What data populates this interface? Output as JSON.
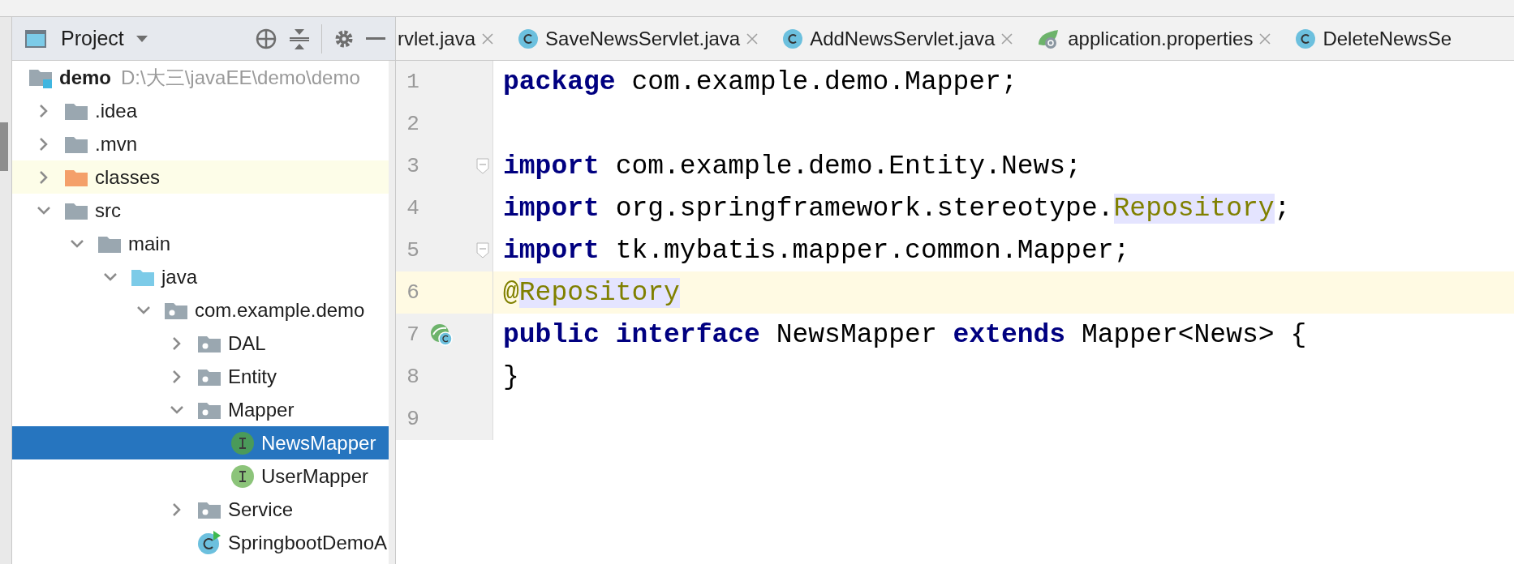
{
  "tool_window": {
    "title": "Project"
  },
  "editor_tabs": [
    {
      "label": "rvlet.java",
      "kind": "partial"
    },
    {
      "label": "SaveNewsServlet.java",
      "kind": "class"
    },
    {
      "label": "AddNewsServlet.java",
      "kind": "class"
    },
    {
      "label": "application.properties",
      "kind": "spring-config"
    },
    {
      "label": "DeleteNewsSe",
      "kind": "class",
      "closable": false
    }
  ],
  "project_tree": {
    "root": {
      "label": "demo",
      "path": "D:\\大三\\javaEE\\demo\\demo",
      "kind": "module",
      "selected": false,
      "highlighted": false,
      "children": [
        {
          "label": ".idea",
          "kind": "folder",
          "expanded": false,
          "selected": false,
          "highlighted": false
        },
        {
          "label": ".mvn",
          "kind": "folder",
          "expanded": false,
          "selected": false,
          "highlighted": false
        },
        {
          "label": "classes",
          "kind": "folder-excluded",
          "expanded": false,
          "selected": false,
          "highlighted": true
        },
        {
          "label": "src",
          "kind": "folder",
          "expanded": true,
          "selected": false,
          "highlighted": false,
          "children": [
            {
              "label": "main",
              "kind": "folder",
              "expanded": true,
              "selected": false,
              "highlighted": false,
              "children": [
                {
                  "label": "java",
                  "kind": "folder-source",
                  "expanded": true,
                  "selected": false,
                  "highlighted": false,
                  "children": [
                    {
                      "label": "com.example.demo",
                      "kind": "package",
                      "expanded": true,
                      "selected": false,
                      "highlighted": false,
                      "children": [
                        {
                          "label": "DAL",
                          "kind": "package",
                          "expanded": false,
                          "selected": false,
                          "highlighted": false
                        },
                        {
                          "label": "Entity",
                          "kind": "package",
                          "expanded": false,
                          "selected": false,
                          "highlighted": false
                        },
                        {
                          "label": "Mapper",
                          "kind": "package",
                          "expanded": true,
                          "selected": false,
                          "highlighted": false,
                          "children": [
                            {
                              "label": "NewsMapper",
                              "kind": "interface",
                              "selected": true,
                              "highlighted": false
                            },
                            {
                              "label": "UserMapper",
                              "kind": "interface",
                              "selected": false,
                              "highlighted": false
                            }
                          ]
                        },
                        {
                          "label": "Service",
                          "kind": "package",
                          "expanded": false,
                          "selected": false,
                          "highlighted": false
                        },
                        {
                          "label": "SpringbootDemoA",
                          "kind": "spring-class",
                          "selected": false,
                          "highlighted": false
                        }
                      ]
                    }
                  ]
                }
              ]
            }
          ]
        }
      ]
    }
  },
  "code_lines": [
    {
      "number": "1",
      "current": false,
      "fold": false,
      "gutter_marker": false,
      "tokens": [
        {
          "kind": "keyword",
          "text": "package"
        },
        {
          "kind": "plain",
          "text": " com.example.demo.Mapper;"
        }
      ]
    },
    {
      "number": "2",
      "current": false,
      "fold": false,
      "gutter_marker": false
    },
    {
      "number": "3",
      "current": false,
      "fold": true,
      "gutter_marker": false,
      "tokens": [
        {
          "kind": "keyword",
          "text": "import"
        },
        {
          "kind": "plain",
          "text": " com.example.demo.Entity.News;"
        }
      ]
    },
    {
      "number": "4",
      "current": false,
      "fold": false,
      "gutter_marker": false,
      "tokens": [
        {
          "kind": "keyword",
          "text": "import"
        },
        {
          "kind": "plain",
          "text": " org.springframework.stereotype."
        },
        {
          "kind": "usage",
          "text": "Repository"
        },
        {
          "kind": "plain",
          "text": ";"
        }
      ]
    },
    {
      "number": "5",
      "current": false,
      "fold": true,
      "gutter_marker": false,
      "tokens": [
        {
          "kind": "keyword",
          "text": "import"
        },
        {
          "kind": "plain",
          "text": " tk.mybatis.mapper.common.Mapper;"
        }
      ]
    },
    {
      "number": "6",
      "current": true,
      "fold": false,
      "gutter_marker": false,
      "tokens": [
        {
          "kind": "annotation",
          "text": "@"
        },
        {
          "kind": "usage",
          "text": "Repository"
        }
      ]
    },
    {
      "number": "7",
      "current": false,
      "fold": false,
      "gutter_marker": true,
      "tokens": [
        {
          "kind": "keyword",
          "text": "public"
        },
        {
          "kind": "keyword",
          "text": " interface"
        },
        {
          "kind": "plain",
          "text": " NewsMapper "
        },
        {
          "kind": "keyword",
          "text": "extends"
        },
        {
          "kind": "plain",
          "text": " Mapper<News> {"
        }
      ]
    },
    {
      "number": "8",
      "current": false,
      "fold": false,
      "gutter_marker": false,
      "tokens": [
        {
          "kind": "plain",
          "text": "}"
        }
      ]
    },
    {
      "number": "9",
      "current": false,
      "fold": false,
      "gutter_marker": false
    }
  ]
}
